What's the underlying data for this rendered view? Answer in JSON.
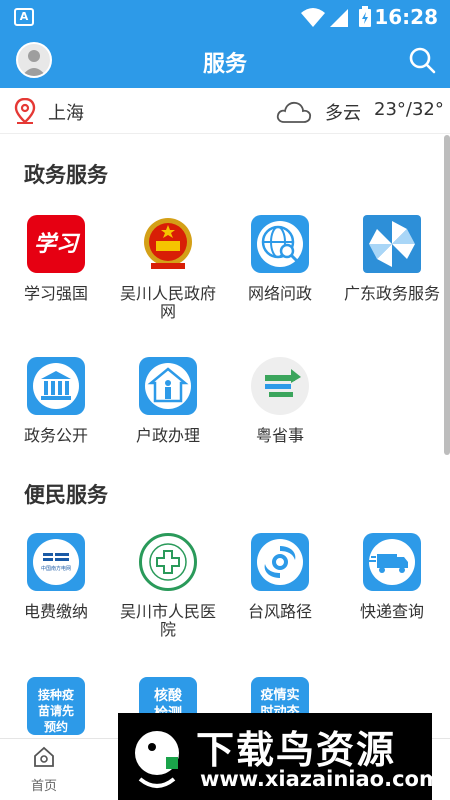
{
  "status_bar": {
    "time": "16:28",
    "notification_icon": "a-icon"
  },
  "header": {
    "title": "服务",
    "avatar_icon": "avatar-icon",
    "search_icon": "search-icon"
  },
  "location": {
    "city": "上海",
    "weather": "多云",
    "temperature": "23°/32°"
  },
  "sections": [
    {
      "title": "政务服务",
      "items": [
        {
          "label": "学习强国",
          "icon": "xuexi-icon"
        },
        {
          "label": "吴川人民政府网",
          "icon": "emblem-icon"
        },
        {
          "label": "网络问政",
          "icon": "globe-search-icon"
        },
        {
          "label": "广东政务服务",
          "icon": "pinwheel-icon"
        },
        {
          "label": "政务公开",
          "icon": "government-building-icon"
        },
        {
          "label": "户政办理",
          "icon": "person-house-icon"
        },
        {
          "label": "粤省事",
          "icon": "yue-icon"
        }
      ]
    },
    {
      "title": "便民服务",
      "items": [
        {
          "label": "电费缴纳",
          "icon": "power-grid-icon",
          "icon_text": "中国南方电网"
        },
        {
          "label": "吴川市人民医院",
          "icon": "hospital-icon"
        },
        {
          "label": "台风路径",
          "icon": "typhoon-icon"
        },
        {
          "label": "快递查询",
          "icon": "delivery-truck-icon"
        },
        {
          "label": "",
          "icon": "vaccine-icon",
          "icon_text": "接种疫苗请先预约"
        },
        {
          "label": "",
          "icon": "nucleic-test-icon",
          "icon_text": "核酸检测"
        },
        {
          "label": "",
          "icon": "epidemic-icon",
          "icon_text": "疫情实时动态"
        }
      ]
    }
  ],
  "ad": {
    "title": "下载鸟资源",
    "url": "www.xiazainiao.com"
  },
  "bottom_nav": {
    "home_label": "首页"
  },
  "colors": {
    "primary": "#2d9ae8",
    "xuexi_red": "#e60012",
    "text": "#333333"
  }
}
